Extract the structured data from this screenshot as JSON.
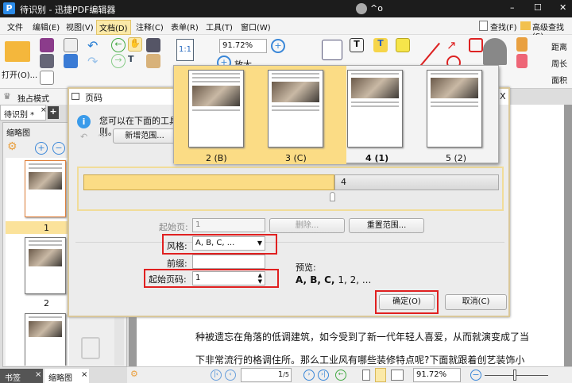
{
  "window": {
    "title": "待识别 - 迅捷PDF编辑器",
    "user": "^o",
    "minimize": "–",
    "maximize": "☐",
    "close": "✕"
  },
  "menu": [
    "文件",
    "编辑(E)",
    "视图(V)",
    "文档(D)",
    "注释(C)",
    "表单(R)",
    "工具(T)",
    "窗口(W)"
  ],
  "menu_right": {
    "find": "查找(F)",
    "advanced_find": "高级查找(S)"
  },
  "toolbar": {
    "open": "打开(O)...",
    "zoom_value": "91.72%",
    "zoom_in": "放大",
    "distance": "距离",
    "perimeter": "周长",
    "area": "面积",
    "actual_size": "1:1"
  },
  "exclusive_mode": "独占模式",
  "doc_tab": {
    "label": "待识别 *",
    "close": "×",
    "add": "+"
  },
  "sidebar": {
    "title": "缩略图",
    "pages": [
      "1",
      "2"
    ],
    "bottom_tabs": [
      {
        "label": "书签",
        "close": "×"
      },
      {
        "label": "缩略图",
        "close": "×"
      }
    ]
  },
  "document": {
    "lines": [
      "种被遗忘在角落的低调建筑，如今受到了新一代年轻人喜爱，从而就演变成了当",
      "下非常流行的格调住所。那么工业风有哪些装修特点呢?下面就跟着创艺装饰小"
    ]
  },
  "statusbar": {
    "page_input": "1",
    "page_total": "/5",
    "zoom": "91.72%"
  },
  "dialog": {
    "title": "页码",
    "close": "X",
    "info": "您可以在下面的工具栏",
    "info2": "则。",
    "add_range": "新增范围...",
    "range_marker": "4",
    "start_page_label": "起始页:",
    "start_page_value": "1",
    "delete": "删除...",
    "reset_range": "重置范围...",
    "style_label": "风格:",
    "style_value": "A, B, C, ...",
    "prefix_label": "前缀:",
    "prefix_value": "",
    "start_number_label": "起始页码:",
    "start_number_value": "1",
    "preview_label": "预览:",
    "preview_bold": "A, B, C,",
    "preview_rest": " 1, 2, ...",
    "ok": "确定(O)",
    "cancel": "取消(C)"
  },
  "page_popup": [
    {
      "label": "2 (B)",
      "selected": true
    },
    {
      "label": "3 (C)",
      "selected": true
    },
    {
      "label": "4 (1)",
      "selected": false,
      "bold": true
    },
    {
      "label": "5 (2)",
      "selected": false
    }
  ]
}
